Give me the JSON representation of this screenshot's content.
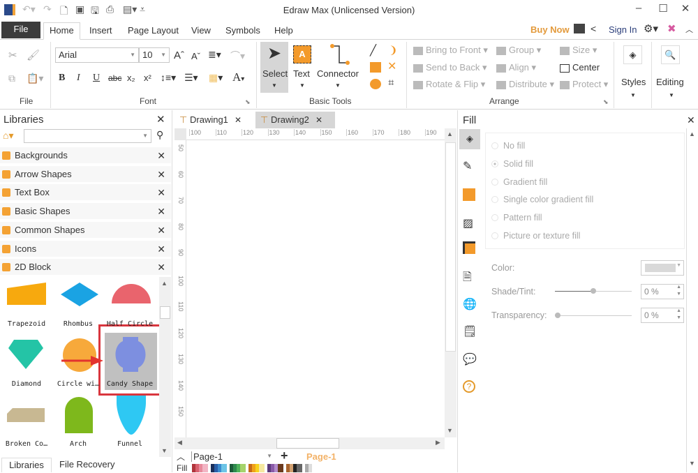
{
  "app": {
    "title": "Edraw Max (Unlicensed Version)"
  },
  "window": {
    "minimize": "–",
    "maximize": "☐",
    "close": "✕"
  },
  "menu": {
    "tabs": [
      "File",
      "Home",
      "Insert",
      "Page Layout",
      "View",
      "Symbols",
      "Help"
    ],
    "active": "Home",
    "buy_now": "Buy Now",
    "sign_in": "Sign In"
  },
  "ribbon": {
    "file_group": "File",
    "font_group": "Font",
    "font_name": "Arial",
    "font_size": "10",
    "basic_tools_group": "Basic Tools",
    "select": "Select",
    "text": "Text",
    "connector": "Connector",
    "arrange_group": "Arrange",
    "bring_to_front": "Bring to Front",
    "send_to_back": "Send to Back",
    "rotate_flip": "Rotate & Flip",
    "group": "Group",
    "align": "Align",
    "distribute": "Distribute",
    "size": "Size",
    "center": "Center",
    "protect": "Protect",
    "styles": "Styles",
    "editing": "Editing"
  },
  "libraries": {
    "title": "Libraries",
    "categories": [
      "Backgrounds",
      "Arrow Shapes",
      "Text Box",
      "Basic Shapes",
      "Common Shapes",
      "Icons",
      "2D Block"
    ],
    "shapes": [
      {
        "name": "Trapezoid",
        "color": "#f7a90e"
      },
      {
        "name": "Rhombus",
        "color": "#1aa3e3"
      },
      {
        "name": "Half Circle",
        "color": "#e9646d"
      },
      {
        "name": "Diamond",
        "color": "#24c4a6"
      },
      {
        "name": "Circle wi…",
        "color": "#f7a93b"
      },
      {
        "name": "Candy Shape",
        "color": "#7d8fe0"
      },
      {
        "name": "Broken Co…",
        "color": "#c8b892"
      },
      {
        "name": "Arch",
        "color": "#7eb81c"
      },
      {
        "name": "Funnel",
        "color": "#2ec8f3"
      }
    ],
    "selected": "Candy Shape",
    "bottom_tabs": [
      "Libraries",
      "File Recovery"
    ]
  },
  "documents": {
    "tabs": [
      "Drawing1",
      "Drawing2"
    ],
    "active": "Drawing2",
    "h_ruler": [
      "100",
      "110",
      "120",
      "130",
      "140",
      "150",
      "160",
      "170",
      "180",
      "190"
    ],
    "v_ruler": [
      "50",
      "60",
      "70",
      "80",
      "90",
      "100",
      "110",
      "120",
      "130",
      "140",
      "150"
    ]
  },
  "pages": {
    "selector": "Page-1",
    "add": "+",
    "current": "Page-1",
    "fill_label": "Fill"
  },
  "palette": [
    "#b0353c",
    "#d9606e",
    "#e88a9c",
    "#f2b5c4",
    "#1b2f5a",
    "#2a5ea8",
    "#3b8ccf",
    "#6cc4e6",
    "#1c5a3a",
    "#2e8a4e",
    "#4fb35a",
    "#a5d36b",
    "#c76a1a",
    "#f0a21a",
    "#f7d21f",
    "#f5e8a0",
    "#5b3a7a",
    "#8a5aa8",
    "#b48ccc",
    "#6a3a1e",
    "#a8642e",
    "#d2a070",
    "#222222",
    "#666666",
    "#aaaaaa",
    "#dddddd"
  ],
  "fill_panel": {
    "title": "Fill",
    "options": [
      "No fill",
      "Solid fill",
      "Gradient fill",
      "Single color gradient fill",
      "Pattern fill",
      "Picture or texture fill"
    ],
    "selected": "Solid fill",
    "color_label": "Color:",
    "color_value": "#d9d9d9",
    "shade_label": "Shade/Tint:",
    "shade_value": "0 %",
    "shade_slider": 0.5,
    "transparency_label": "Transparency:",
    "transparency_value": "0 %",
    "transparency_slider": 0
  },
  "colors": {
    "accent": "#f39a2b",
    "file_tab": "#3c3c3c",
    "highlight": "#d9363e"
  }
}
